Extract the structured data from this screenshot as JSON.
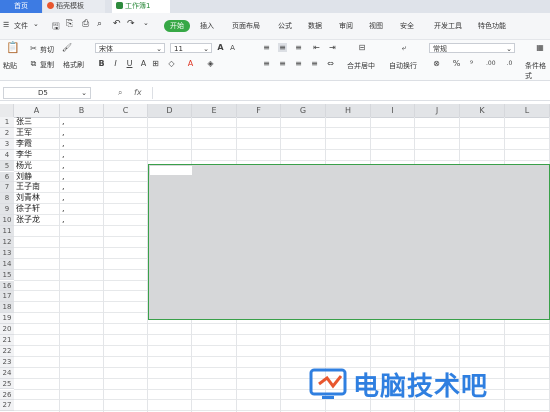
{
  "tabs": [
    {
      "label": "首页"
    },
    {
      "label": "稻壳模板"
    },
    {
      "label": "工作簿1"
    }
  ],
  "menu": {
    "file": "文件",
    "items": [
      "开始",
      "插入",
      "页面布局",
      "公式",
      "数据",
      "审阅",
      "视图",
      "安全",
      "开发工具",
      "特色功能"
    ]
  },
  "ribbon": {
    "paste": "粘贴",
    "cut": "剪切",
    "copy": "复制",
    "format_painter": "格式刷",
    "font_name": "宋体",
    "font_size": "11",
    "merge_center": "合并居中",
    "wrap_text": "自动换行",
    "number_format": "常规",
    "conditional_format": "条件格式"
  },
  "formula_bar": {
    "cell_ref": "D5",
    "fx": "fx",
    "value": ""
  },
  "columns": [
    "A",
    "B",
    "C",
    "D",
    "E",
    "F",
    "G",
    "H",
    "I",
    "J",
    "K",
    "L"
  ],
  "rows": [
    "1",
    "2",
    "3",
    "4",
    "5",
    "6",
    "7",
    "8",
    "9",
    "10",
    "11",
    "12",
    "13",
    "14",
    "15",
    "16",
    "17",
    "18",
    "19",
    "20",
    "21",
    "22",
    "23",
    "24",
    "25",
    "26",
    "27"
  ],
  "cells": {
    "A": [
      "张三",
      "王军",
      "李霞",
      "李华",
      "杨光",
      "刘静",
      "王子南",
      "刘青林",
      "徐子轩",
      "张子龙"
    ],
    "B": [
      ",",
      ",",
      ",",
      ",",
      ",",
      ",",
      ",",
      ",",
      ",",
      ","
    ]
  },
  "watermark": {
    "text": "电脑技术吧"
  },
  "colors": {
    "accent_green": "#3aa04a",
    "tab_blue": "#3d7be3",
    "selection_gray": "#d6d7d9",
    "watermark_blue": "#2f7fe0"
  }
}
